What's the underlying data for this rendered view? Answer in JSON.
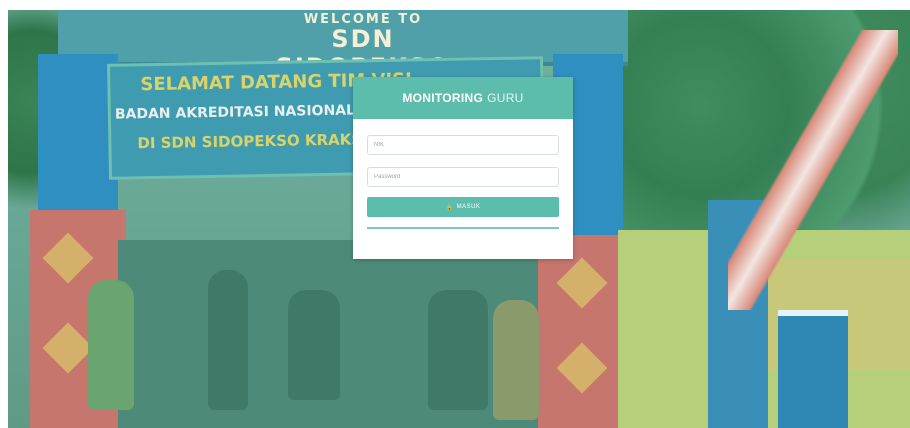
{
  "sign": {
    "welcome_line": "WELCOME TO",
    "school_name": "SDN SIDOPEKSO"
  },
  "banner": {
    "line1": "SELAMAT DATANG TIM VISI",
    "line2": "BADAN AKREDITASI NASIONAL PROVINSI",
    "line3": "DI SDN SIDOPEKSO KRAKSA"
  },
  "login": {
    "title_strong": "MONITORING",
    "title_light": "GURU",
    "username_placeholder": "NIK",
    "password_placeholder": "Password",
    "submit_label": "MASUK",
    "submit_icon": "lock-icon"
  },
  "colors": {
    "accent": "#5dbdac",
    "panel_bg": "#ffffff"
  }
}
